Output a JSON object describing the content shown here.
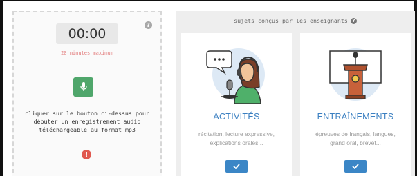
{
  "recorder": {
    "timer": "00:00",
    "max_note": "20 minutes maximum",
    "instructions": [
      "cliquer sur le bouton ci-dessus pour",
      "débuter un enregistrement audio",
      "téléchargeable au format mp3"
    ],
    "help_icon": "question-circle-icon",
    "mic_icon": "microphone-icon",
    "alert_icon": "exclamation-circle-icon"
  },
  "teacher_section": {
    "heading": "sujets conçus par les enseignants",
    "cards": [
      {
        "title": "ACTIVITÉS",
        "description_lines": [
          "récitation, lecture expressive,",
          "explications orales..."
        ],
        "illustration": "podcaster-headset-illustration",
        "button_icon": "check-icon"
      },
      {
        "title": "ENTRAÎNEMENTS",
        "description_lines": [
          "épreuves de français, langues,",
          "grand oral, brevet..."
        ],
        "illustration": "lectern-microphone-illustration",
        "button_icon": "check-icon"
      }
    ]
  },
  "colors": {
    "mic_button": "#4fa66b",
    "accent_blue": "#3a7fc1",
    "note_red": "#e27b7b",
    "alert_red": "#e0584f"
  }
}
